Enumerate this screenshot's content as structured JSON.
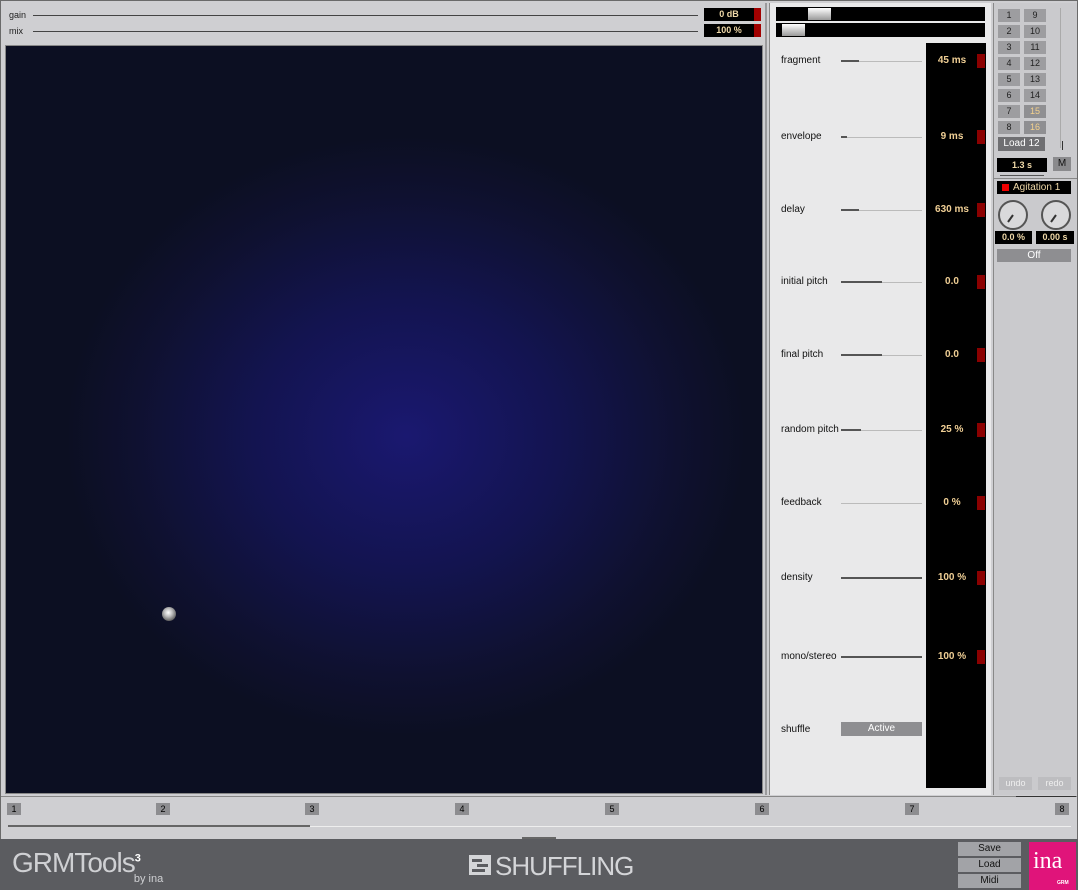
{
  "top": {
    "gain": {
      "label": "gain",
      "value": "0 dB"
    },
    "mix": {
      "label": "mix",
      "value": "100 %"
    }
  },
  "params": [
    {
      "label": "fragment",
      "value": "45 ms",
      "level": 0.22
    },
    {
      "label": "envelope",
      "value": "9 ms",
      "level": 0.08
    },
    {
      "label": "delay",
      "value": "630 ms",
      "level": 0.22
    },
    {
      "label": "initial pitch",
      "value": "0.0",
      "level": 0.5
    },
    {
      "label": "final pitch",
      "value": "0.0",
      "level": 0.5
    },
    {
      "label": "random pitch",
      "value": "25 %",
      "level": 0.25
    },
    {
      "label": "feedback",
      "value": "0 %",
      "level": 0.0
    },
    {
      "label": "density",
      "value": "100 %",
      "level": 1.0
    },
    {
      "label": "mono/stereo",
      "value": "100 %",
      "level": 1.0
    }
  ],
  "shuffle": {
    "label": "shuffle",
    "button": "Active"
  },
  "presets": {
    "left": [
      "1",
      "2",
      "3",
      "4",
      "5",
      "6",
      "7",
      "8"
    ],
    "right": [
      "9",
      "10",
      "11",
      "12",
      "13",
      "14",
      "15",
      "16"
    ],
    "load_label": "Load 12",
    "time_value": "1.3 s",
    "m_label": "M"
  },
  "agitation": {
    "label": "Agitation 1",
    "knob1_value": "0.0 %",
    "knob2_value": "0.00 s",
    "toggle": "Off"
  },
  "undo_label": "undo",
  "redo_label": "redo",
  "timeline": [
    "1",
    "2",
    "3",
    "4",
    "5",
    "6",
    "7",
    "8"
  ],
  "footer": {
    "brand": "GRMTools",
    "brand_sup": "3",
    "brand_by": "by ina",
    "plugin_name": "SHUFFLING",
    "save": "Save",
    "load": "Load",
    "midi": "Midi",
    "ina_logo": "ina",
    "ina_sub": "GRM"
  },
  "colors": {
    "value_text": "#f0cf95",
    "meter_red": "#8b0000",
    "pad_center": "#1a1870",
    "ina_pink": "#e0147a"
  }
}
